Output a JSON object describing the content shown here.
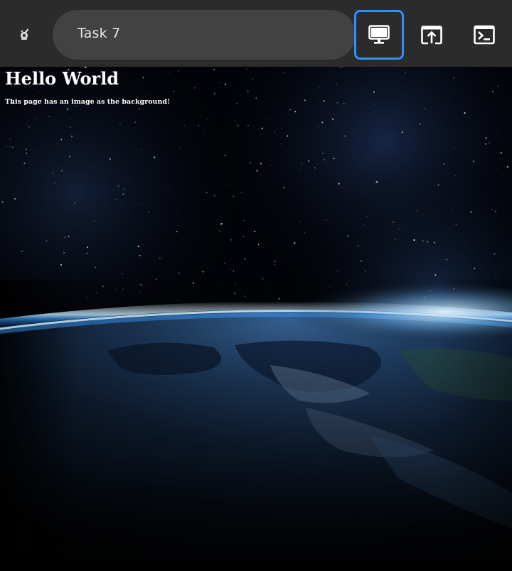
{
  "toolbar": {
    "logo_icon": "app-logo-icon",
    "task_title": "Task 7",
    "buttons": [
      {
        "icon": "monitor-icon",
        "active": true
      },
      {
        "icon": "open-external-icon",
        "active": false
      },
      {
        "icon": "terminal-icon",
        "active": false
      }
    ],
    "colors": {
      "bar": "#2b2b2b",
      "field": "#424242",
      "active_border": "#2f8fff"
    }
  },
  "page": {
    "heading": "Hello World",
    "body_text": "This page has an image as the background!",
    "background": "earth-from-space-image"
  }
}
